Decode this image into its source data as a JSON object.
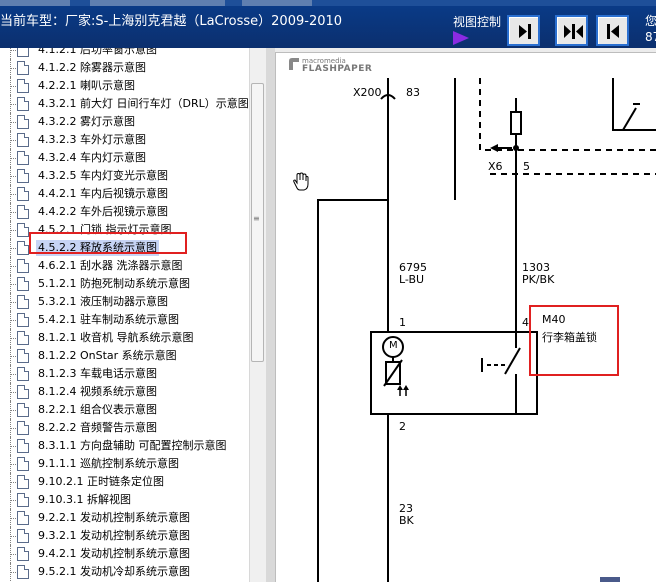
{
  "header": {
    "vehicle": "当前车型：厂家:S-上海别克君越（LaCrosse）2009-2010",
    "view_control_label": "视图控制",
    "right_text_1": "您",
    "right_text_2": "87"
  },
  "view_buttons": [
    {
      "name": "next-page",
      "icon": "arrow-right-bar-icon"
    },
    {
      "name": "fit-page",
      "icon": "double-arrow-icon"
    },
    {
      "name": "prev-page",
      "icon": "arrow-left-bar-icon"
    }
  ],
  "tree": {
    "items": [
      "4.1.2.1 后功率窗示意图",
      "4.1.2.2 除雾器示意图",
      "4.2.2.1 喇叭示意图",
      "4.3.2.1 前大灯 日间行车灯（DRL）示意图",
      "4.3.2.2 雾灯示意图",
      "4.3.2.3 车外灯示意图",
      "4.3.2.4 车内灯示意图",
      "4.3.2.5 车内灯变光示意图",
      "4.4.2.1 车内后视镜示意图",
      "4.4.2.2 车外后视镜示意图",
      "4.5.2.1 门锁 指示灯示意图",
      "4.5.2.2 释放系统示意图",
      "4.6.2.1 刮水器 洗涤器示意图",
      "5.1.2.1 防抱死制动系统示意图",
      "5.3.2.1 液压制动器示意图",
      "5.4.2.1 驻车制动系统示意图",
      "8.1.2.1 收音机 导航系统示意图",
      "8.1.2.2 OnStar 系统示意图",
      "8.1.2.3 车载电话示意图",
      "8.1.2.4 视频系统示意图",
      "8.2.2.1 组合仪表示意图",
      "8.2.2.2 音频警告示意图",
      "8.3.1.1 方向盘辅助 可配置控制示意图",
      "9.1.1.1 巡航控制系统示意图",
      "9.10.2.1 正时链条定位图",
      "9.10.3.1 拆解视图",
      "9.2.2.1 发动机控制系统示意图",
      "9.3.2.1 发动机控制系统示意图",
      "9.4.2.1 发动机控制系统示意图",
      "9.5.2.1 发动机冷却系统示意图"
    ],
    "selected_index": 11
  },
  "viewer": {
    "logo_top": "macromedia",
    "logo_bottom": "FLASHPAPER"
  },
  "diagram": {
    "x200": "X200",
    "pin83": "83",
    "x6": "X6",
    "pin5": "5",
    "wire1_num": "6795",
    "wire1_color": "L-BU",
    "wire2_num": "1303",
    "wire2_color": "PK/BK",
    "pin1": "1",
    "pin4": "4",
    "pin2": "2",
    "motor_label": "M",
    "component": "M40",
    "component_desc": "行李箱盖锁",
    "wire3_num": "23",
    "wire3_color": "BK"
  },
  "colors": {
    "header_bg": "#0b2f6e",
    "highlight_red": "#e02020",
    "selection_bg": "#c7d4f5",
    "view_arrow": "#8a2be2"
  }
}
